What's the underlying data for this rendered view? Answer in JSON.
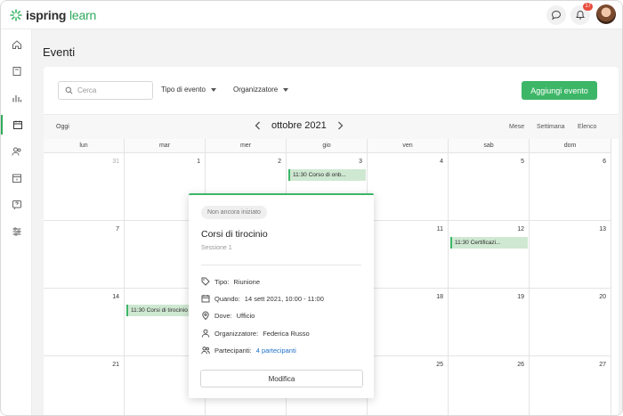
{
  "app": {
    "logo_prefix": "ispring",
    "logo_suffix": "learn",
    "brand_color": "#3db667",
    "notifications_count": "17"
  },
  "sidebar": {
    "items": [
      {
        "icon": "home-icon"
      },
      {
        "icon": "book-icon"
      },
      {
        "icon": "bar-chart-icon"
      },
      {
        "icon": "calendar-icon",
        "active": true
      },
      {
        "icon": "users-icon"
      },
      {
        "icon": "catalog-icon"
      },
      {
        "icon": "question-icon"
      },
      {
        "icon": "sliders-icon"
      }
    ]
  },
  "page": {
    "title": "Eventi"
  },
  "toolbar": {
    "search_placeholder": "Cerca",
    "filter_type": "Tipo di evento",
    "filter_organizer": "Organizzatore",
    "add_button": "Aggiungi evento"
  },
  "calendar": {
    "today_label": "Oggi",
    "month_label": "ottobre 2021",
    "views": [
      "Mese",
      "Settimana",
      "Elenco"
    ],
    "weekdays": [
      "lun",
      "mar",
      "mer",
      "gio",
      "ven",
      "sab",
      "dom"
    ],
    "weeks": [
      [
        "31",
        "1",
        "2",
        "3",
        "4",
        "5",
        "6"
      ],
      [
        "7",
        "",
        "",
        "",
        "11",
        "12",
        "13"
      ],
      [
        "14",
        "",
        "",
        "",
        "18",
        "19",
        "20"
      ],
      [
        "21",
        "",
        "",
        "",
        "25",
        "26",
        "27"
      ]
    ],
    "events": [
      {
        "label": "11:30 Corso di onb...",
        "week": 0,
        "day": 3
      },
      {
        "label": "11:30 Certificazi...",
        "week": 1,
        "day": 5
      },
      {
        "label": "11:30 Corsi di tirocinio",
        "week": 2,
        "day": 1
      }
    ]
  },
  "popover": {
    "status": "Non ancora iniziato",
    "title": "Corsi di tirocinio",
    "subtitle": "Sessione 1",
    "type_label": "Tipo:",
    "type_value": "Riunione",
    "when_label": "Quando:",
    "when_value": "14 sett 2021, 10:00 - 11:00",
    "where_label": "Dove:",
    "where_value": "Ufficio",
    "organizer_label": "Organizzatore:",
    "organizer_value": "Federica Russo",
    "participants_label": "Partecipanti:",
    "participants_value": "4 partecipanti",
    "edit_button": "Modifica"
  }
}
